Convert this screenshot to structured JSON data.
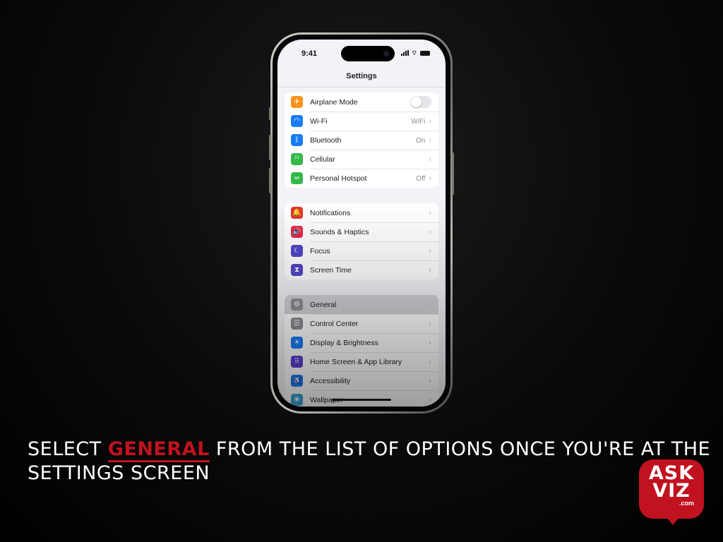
{
  "status_bar": {
    "time": "9:41"
  },
  "screen_title": "Settings",
  "groups": [
    {
      "items": [
        {
          "label": "Airplane Mode",
          "icon": "airplane-icon",
          "color": "#f7941d",
          "glyph": "✈",
          "control": "toggle",
          "toggle_on": false
        },
        {
          "label": "Wi-Fi",
          "icon": "wifi-icon",
          "color": "#1a7cf5",
          "glyph": "◠",
          "value": "WiFi"
        },
        {
          "label": "Bluetooth",
          "icon": "bluetooth-icon",
          "color": "#1a7cf5",
          "glyph": "ᛒ",
          "value": "On"
        },
        {
          "label": "Cellular",
          "icon": "cellular-icon",
          "color": "#34b84a",
          "glyph": "⁽ⁱ⁾",
          "value": ""
        },
        {
          "label": "Personal Hotspot",
          "icon": "hotspot-icon",
          "color": "#34b84a",
          "glyph": "∞",
          "value": "Off"
        }
      ]
    },
    {
      "items": [
        {
          "label": "Notifications",
          "icon": "notifications-icon",
          "color": "#e5352b",
          "glyph": "🔔",
          "value": ""
        },
        {
          "label": "Sounds & Haptics",
          "icon": "sounds-icon",
          "color": "#e5284a",
          "glyph": "🔊",
          "value": ""
        },
        {
          "label": "Focus",
          "icon": "focus-moon-icon",
          "color": "#5147c8",
          "glyph": "☾",
          "value": ""
        },
        {
          "label": "Screen Time",
          "icon": "screen-time-hourglass-icon",
          "color": "#5147c8",
          "glyph": "⧗",
          "value": ""
        }
      ]
    },
    {
      "items": [
        {
          "label": "General",
          "icon": "gear-icon",
          "color": "#8e8e93",
          "glyph": "⚙",
          "value": "",
          "highlighted": true
        },
        {
          "label": "Control Center",
          "icon": "control-center-icon",
          "color": "#8e8e93",
          "glyph": "☰",
          "value": ""
        },
        {
          "label": "Display & Brightness",
          "icon": "brightness-icon",
          "color": "#1a7cf5",
          "glyph": "☀",
          "value": ""
        },
        {
          "label": "Home Screen & App Library",
          "icon": "home-screen-icon",
          "color": "#5d3fd3",
          "glyph": "⠿",
          "value": ""
        },
        {
          "label": "Accessibility",
          "icon": "accessibility-icon",
          "color": "#1a7cf5",
          "glyph": "♿",
          "value": ""
        },
        {
          "label": "Wallpaper",
          "icon": "wallpaper-icon",
          "color": "#35a6d6",
          "glyph": "❀",
          "value": ""
        }
      ]
    }
  ],
  "caption": {
    "before": "SELECT ",
    "highlight": "GENERAL",
    "after": " FROM THE LIST OF OPTIONS ONCE YOU'RE AT THE SETTINGS SCREEN",
    "highlight_color": "#c1121f"
  },
  "logo": {
    "line1": "ASK",
    "line2": "VIZ",
    "line3": ".com",
    "color": "#c1121f"
  }
}
